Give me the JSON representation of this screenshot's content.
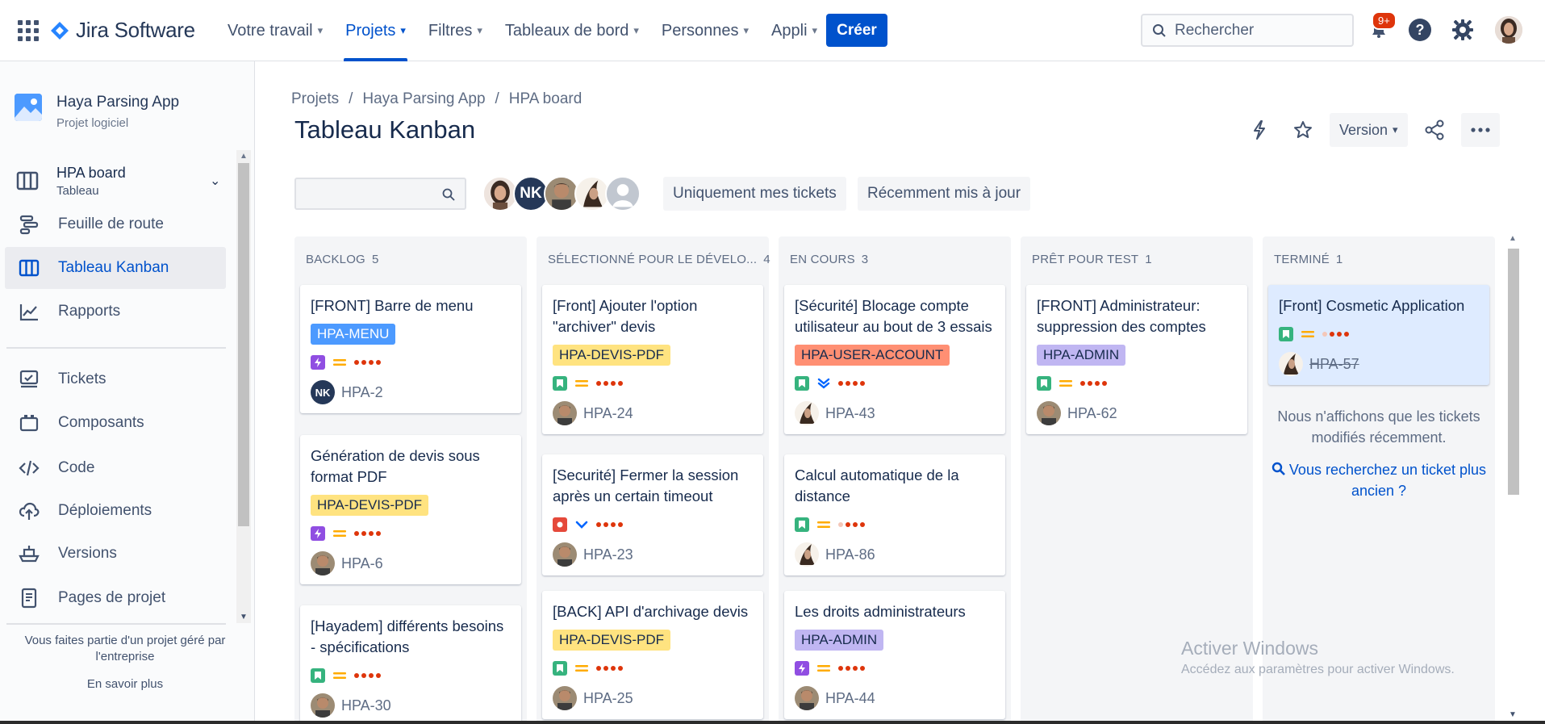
{
  "topnav": {
    "brand": "Jira Software",
    "menu": [
      {
        "label": "Votre travail"
      },
      {
        "label": "Projets"
      },
      {
        "label": "Filtres"
      },
      {
        "label": "Tableaux de bord"
      },
      {
        "label": "Personnes"
      },
      {
        "label": "Appli"
      }
    ],
    "create": "Créer",
    "search_placeholder": "Rechercher",
    "notifications_badge": "9+",
    "accent_color": "#0052cc"
  },
  "sidebar": {
    "project_name": "Haya Parsing App",
    "project_type": "Projet logiciel",
    "board_name": "HPA board",
    "board_type": "Tableau",
    "items": [
      {
        "label": "Feuille de route",
        "icon": "roadmap-icon"
      },
      {
        "label": "Tableau Kanban",
        "icon": "board-columns-icon"
      },
      {
        "label": "Rapports",
        "icon": "chart-line-icon"
      },
      {
        "label": "Tickets",
        "icon": "tickets-icon"
      },
      {
        "label": "Composants",
        "icon": "components-icon"
      },
      {
        "label": "Code",
        "icon": "code-icon"
      },
      {
        "label": "Déploiements",
        "icon": "cloud-upload-icon"
      },
      {
        "label": "Versions",
        "icon": "ship-icon"
      },
      {
        "label": "Pages de projet",
        "icon": "page-icon"
      }
    ],
    "footer_text": "Vous faites partie d'un projet géré par l'entreprise",
    "footer_link": "En savoir plus"
  },
  "main": {
    "breadcrumbs": [
      "Projets",
      "Haya Parsing App",
      "HPA board"
    ],
    "title": "Tableau Kanban",
    "version_label": "Version",
    "filter_mine": "Uniquement mes tickets",
    "filter_recent": "Récemment mis à jour",
    "avatar_initials": "NK"
  },
  "board": {
    "columns": [
      {
        "name": "BACKLOG",
        "count": "5",
        "cards": [
          {
            "summary": "[FRONT] Barre de menu",
            "epic": "HPA-MENU",
            "epic_bg": "#4c9aff",
            "epic_fg": "#ffffff",
            "type": "epic",
            "priority": "medium",
            "key": "HPA-2",
            "assignee": "NK"
          },
          {
            "summary": "Génération de devis sous format PDF",
            "epic": "HPA-DEVIS-PDF",
            "epic_bg": "#ffe380",
            "epic_fg": "#172b4d",
            "type": "epic",
            "priority": "medium",
            "key": "HPA-6",
            "assignee": "man"
          },
          {
            "summary": "[Hayadem] différents besoins - spécifications",
            "epic": "",
            "type": "story",
            "priority": "medium",
            "key": "HPA-30",
            "assignee": "man"
          }
        ]
      },
      {
        "name": "SÉLECTIONNÉ POUR LE DÉVELO...",
        "count": "4",
        "cards": [
          {
            "summary": "[Front] Ajouter l'option \"archiver\" devis",
            "epic": "HPA-DEVIS-PDF",
            "epic_bg": "#ffe380",
            "epic_fg": "#172b4d",
            "type": "story",
            "priority": "medium",
            "key": "HPA-24",
            "assignee": "man"
          },
          {
            "summary": "[Securité] Fermer la session après un certain timeout",
            "epic": "",
            "type": "bug",
            "priority": "low",
            "key": "HPA-23",
            "assignee": "man"
          },
          {
            "summary": "[BACK] API d'archivage devis",
            "epic": "HPA-DEVIS-PDF",
            "epic_bg": "#ffe380",
            "epic_fg": "#172b4d",
            "type": "story",
            "priority": "medium",
            "key": "HPA-25",
            "assignee": "man"
          }
        ]
      },
      {
        "name": "EN COURS",
        "count": "3",
        "cards": [
          {
            "summary": "[Sécurité] Blocage compte utilisateur au bout de 3 essais",
            "epic": "HPA-USER-ACCOUNT",
            "epic_bg": "#ff8f73",
            "epic_fg": "#172b4d",
            "type": "story",
            "priority": "lowest",
            "key": "HPA-43",
            "assignee": "woman"
          },
          {
            "summary": "Calcul automatique de la distance",
            "epic": "",
            "type": "story",
            "priority": "medium",
            "key": "HPA-86",
            "assignee": "woman"
          },
          {
            "summary": "Les droits administrateurs",
            "epic": "HPA-ADMIN",
            "epic_bg": "#c0b6f2",
            "epic_fg": "#172b4d",
            "type": "epic",
            "priority": "medium",
            "key": "HPA-44",
            "assignee": "man"
          }
        ]
      },
      {
        "name": "PRÊT POUR TEST",
        "count": "1",
        "cards": [
          {
            "summary": "[FRONT] Administrateur: suppression des comptes",
            "epic": "HPA-ADMIN",
            "epic_bg": "#c0b6f2",
            "epic_fg": "#172b4d",
            "type": "story",
            "priority": "medium",
            "key": "HPA-62",
            "assignee": "man"
          }
        ]
      },
      {
        "name": "TERMINÉ",
        "count": "1",
        "cards": [
          {
            "summary": "[Front] Cosmetic Application",
            "epic": "",
            "type": "story",
            "priority": "medium",
            "key": "HPA-57",
            "assignee": "woman"
          }
        ],
        "note": "Nous n'affichons que les tickets modifiés récemment.",
        "link": "Vous recherchez un ticket plus ancien ?"
      }
    ]
  },
  "watermark": {
    "line1": "Activer Windows",
    "line2": "Accédez aux paramètres pour activer Windows."
  }
}
